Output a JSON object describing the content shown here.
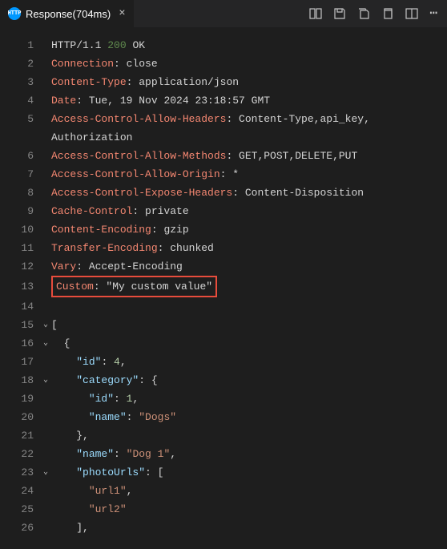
{
  "tab": {
    "title": "Response(704ms)"
  },
  "lines": {
    "1": {
      "protocol": "HTTP/1.1",
      "status_code": "200",
      "status_text": "OK"
    },
    "2": {
      "key": "Connection",
      "value": "close"
    },
    "3": {
      "key": "Content-Type",
      "value": "application/json"
    },
    "4": {
      "key": "Date",
      "value": "Tue, 19 Nov 2024 23:18:57 GMT"
    },
    "5": {
      "key": "Access-Control-Allow-Headers",
      "value": "Content-Type,api_key,"
    },
    "5b": {
      "value": "Authorization"
    },
    "6": {
      "key": "Access-Control-Allow-Methods",
      "value": "GET,POST,DELETE,PUT"
    },
    "7": {
      "key": "Access-Control-Allow-Origin",
      "value": "*"
    },
    "8": {
      "key": "Access-Control-Expose-Headers",
      "value": "Content-Disposition"
    },
    "9": {
      "key": "Cache-Control",
      "value": "private"
    },
    "10": {
      "key": "Content-Encoding",
      "value": "gzip"
    },
    "11": {
      "key": "Transfer-Encoding",
      "value": "chunked"
    },
    "12": {
      "key": "Vary",
      "value": "Accept-Encoding"
    },
    "13": {
      "key": "Custom",
      "value": "\"My custom value\""
    },
    "15": {
      "text": "["
    },
    "16": {
      "text": "{"
    },
    "17": {
      "key": "\"id\"",
      "value": "4",
      "comma": ","
    },
    "18": {
      "key": "\"category\"",
      "value": "{"
    },
    "19": {
      "key": "\"id\"",
      "value": "1",
      "comma": ","
    },
    "20": {
      "key": "\"name\"",
      "value": "\"Dogs\""
    },
    "21": {
      "text": "},"
    },
    "22": {
      "key": "\"name\"",
      "value": "\"Dog 1\"",
      "comma": ","
    },
    "23": {
      "key": "\"photoUrls\"",
      "value": "["
    },
    "24": {
      "value": "\"url1\"",
      "comma": ","
    },
    "25": {
      "value": "\"url2\""
    },
    "26": {
      "text": "],"
    }
  }
}
